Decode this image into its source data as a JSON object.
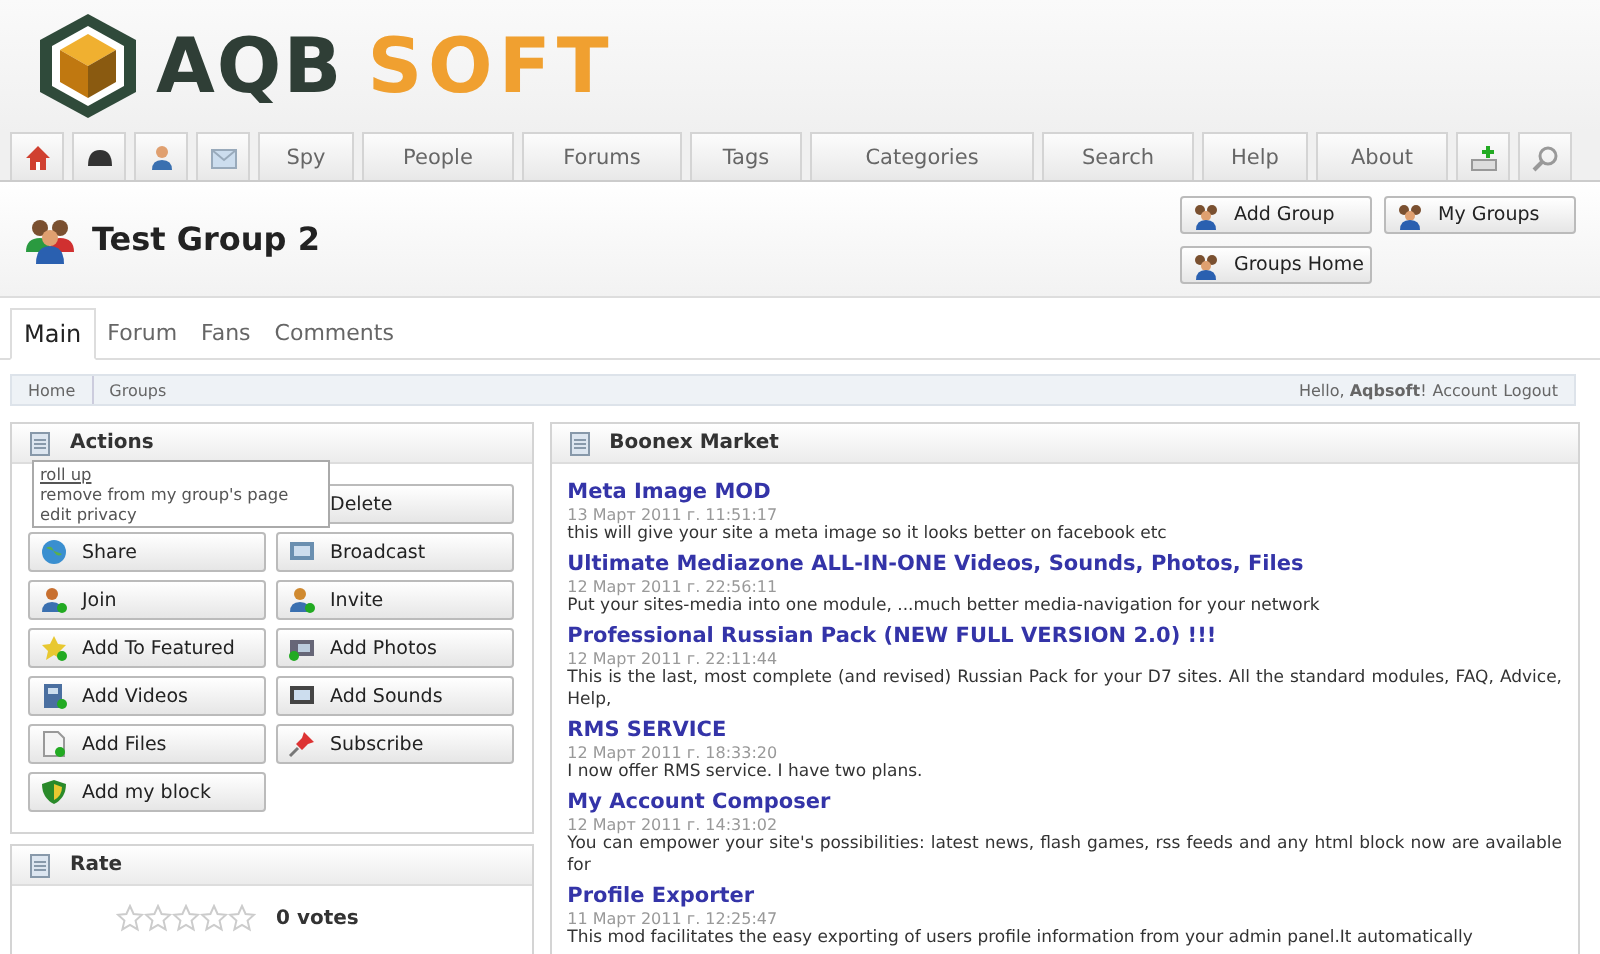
{
  "brand": {
    "word_1": "AQB",
    "word_2": "SOFT"
  },
  "nav": {
    "tabs": [
      {
        "label": "Spy",
        "selected": false
      },
      {
        "label": "People",
        "selected": false
      },
      {
        "label": "Forums",
        "selected": false
      },
      {
        "label": "Tags",
        "selected": false
      },
      {
        "label": "Categories",
        "selected": false
      },
      {
        "label": "Search",
        "selected": false
      },
      {
        "label": "Help",
        "selected": false
      },
      {
        "label": "About",
        "selected": false
      }
    ]
  },
  "page_title": "Test Group 2",
  "header_buttons": [
    "Add Group",
    "My Groups",
    "Groups Home"
  ],
  "subtabs": [
    {
      "label": "Main",
      "selected": true
    },
    {
      "label": "Forum",
      "selected": false
    },
    {
      "label": "Fans",
      "selected": false
    },
    {
      "label": "Comments",
      "selected": false
    }
  ],
  "breadcrumb": [
    "Home",
    "Groups"
  ],
  "account": {
    "greeting": "Hello, ",
    "user": "Aqbsoft",
    "mark": "!",
    "links": [
      "Account",
      "Logout"
    ]
  },
  "actions": {
    "title": "Actions",
    "menu": [
      {
        "label": "roll up",
        "kind": "link"
      },
      {
        "label": "remove from my group's page",
        "kind": "plain"
      },
      {
        "label": "edit privacy",
        "kind": "plain"
      }
    ],
    "buttons": [
      "Delete",
      "Share",
      "Broadcast",
      "Join",
      "Invite",
      "Add To Featured",
      "Add Photos",
      "Add Videos",
      "Add Sounds",
      "Add Files",
      "Subscribe",
      "Add my block"
    ]
  },
  "rate": {
    "title": "Rate",
    "stars": 0,
    "votes": "0 votes"
  },
  "market": {
    "title": "Boonex Market",
    "items": [
      {
        "title": "Meta Image MOD",
        "date": "13 Март 2011 г. 11:51:17",
        "text": "this will give your site a meta image so it looks better on facebook etc"
      },
      {
        "title": "Ultimate Mediazone ALL-IN-ONE Videos, Sounds, Photos, Files",
        "date": "12 Март 2011 г. 22:56:11",
        "text": "Put your sites-media into one module, ...much better media-navigation for your network"
      },
      {
        "title": "Professional Russian Pack (NEW FULL VERSION 2.0) !!!",
        "date": "12 Март 2011 г. 22:11:44",
        "text": "This is the last, most complete (and revised) Russian Pack for your D7 sites. All the standard modules, FAQ, Advice, Help,"
      },
      {
        "title": "RMS SERVICE",
        "date": "12 Март 2011 г. 18:33:20",
        "text": "I now offer RMS service. I have two plans."
      },
      {
        "title": "My Account Composer",
        "date": "12 Март 2011 г. 14:31:02",
        "text": "You can empower your site's possibilities: latest news, flash games, rss feeds and any html block now are available for"
      },
      {
        "title": "Profile Exporter",
        "date": "11 Март 2011 г. 12:25:47",
        "text": "This mod facilitates the easy exporting of users profile information from your admin panel.It automatically"
      }
    ]
  }
}
